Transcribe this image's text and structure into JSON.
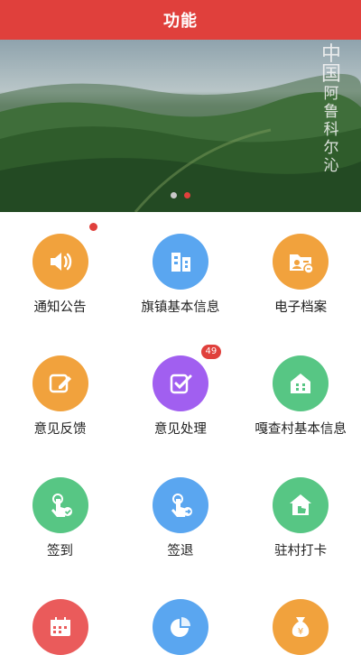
{
  "header": {
    "title": "功能"
  },
  "banner": {
    "calligraphy_top": "中国",
    "calligraphy_vertical": [
      "阿",
      "鲁",
      "科",
      "尔",
      "沁"
    ],
    "active_dot": 1
  },
  "colors": {
    "header": "#e0403c",
    "orange": "#f1a23d",
    "blue": "#5aa6f0",
    "green": "#57c684",
    "purple": "#a15ff0",
    "red": "#ea5b5b"
  },
  "features": [
    {
      "label": "通知公告",
      "icon": "speaker-icon",
      "color": "orange",
      "badge": "dot"
    },
    {
      "label": "旗镇基本信息",
      "icon": "building-icon",
      "color": "blue"
    },
    {
      "label": "电子档案",
      "icon": "folder-icon",
      "color": "orange"
    },
    {
      "label": "意见反馈",
      "icon": "edit-icon",
      "color": "orange"
    },
    {
      "label": "意见处理",
      "icon": "check-icon",
      "color": "purple",
      "badge": "49"
    },
    {
      "label": "嘎查村基本信息",
      "icon": "house-icon",
      "color": "green"
    },
    {
      "label": "签到",
      "icon": "tap-check-icon",
      "color": "green"
    },
    {
      "label": "签退",
      "icon": "tap-arrow-icon",
      "color": "blue"
    },
    {
      "label": "驻村打卡",
      "icon": "home-hand-icon",
      "color": "green"
    },
    {
      "label": "",
      "icon": "calendar-icon",
      "color": "red"
    },
    {
      "label": "",
      "icon": "pie-chart-icon",
      "color": "blue"
    },
    {
      "label": "",
      "icon": "money-bag-icon",
      "color": "orange"
    }
  ]
}
